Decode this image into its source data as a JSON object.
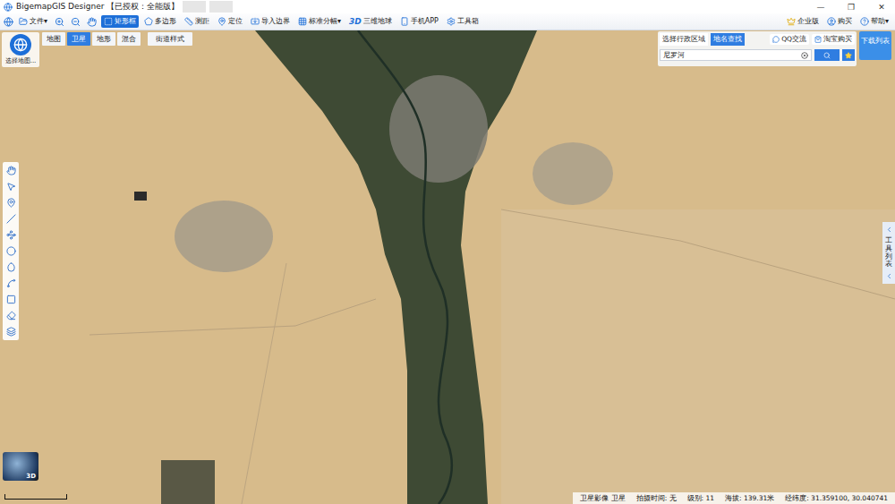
{
  "window": {
    "title": "BigemapGIS Designer 【已授权：全能版】",
    "controls": [
      "—",
      "❐",
      "✕"
    ]
  },
  "toolbar": {
    "file_menu": "文件▾",
    "items": [
      {
        "label": "矩形框",
        "selected": true
      },
      {
        "label": "多边形",
        "selected": false
      },
      {
        "label": "测距",
        "selected": false
      },
      {
        "label": "定位",
        "selected": false
      },
      {
        "label": "导入边界",
        "selected": false
      },
      {
        "label": "标准分幅▾",
        "selected": false
      },
      {
        "label": "三维地球",
        "badge": "3D",
        "selected": false
      },
      {
        "label": "手机APP",
        "selected": false
      },
      {
        "label": "工具箱",
        "selected": false
      }
    ],
    "right": [
      "企业版",
      "购买",
      "帮助▾"
    ]
  },
  "map_picker": {
    "label": "选择地图..."
  },
  "map_tabs": [
    {
      "label": "地图",
      "selected": false
    },
    {
      "label": "卫星",
      "selected": true
    },
    {
      "label": "地形",
      "selected": false
    },
    {
      "label": "混合",
      "selected": false
    },
    {
      "label": "街道样式",
      "selected": false
    }
  ],
  "search_panel": {
    "tabs": [
      {
        "label": "选择行政区域",
        "selected": false
      },
      {
        "label": "地名查找",
        "selected": true
      }
    ],
    "links": [
      "QQ交流",
      "淘宝购买"
    ],
    "value": "尼罗河"
  },
  "download_button": "下载列表",
  "tool_list": {
    "label": "工具列表"
  },
  "mini_globe": {
    "label": "3D"
  },
  "status_bar": [
    "卫星影像 卫星",
    "拍摄时间: 无",
    "级别: 11",
    "海拔: 139.31米",
    "经纬度: 31.359100, 30.040741"
  ]
}
